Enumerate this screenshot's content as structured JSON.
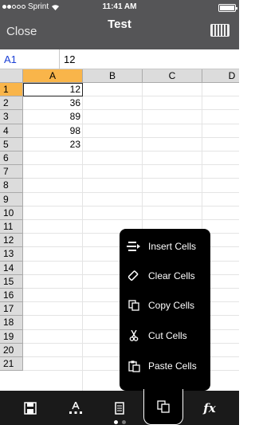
{
  "status_bar": {
    "carrier": "Sprint",
    "time": "11:41 AM"
  },
  "nav": {
    "close_label": "Close",
    "title": "Test",
    "keyboard_icon": "keyboard-icon"
  },
  "formula_bar": {
    "cell_ref": "A1",
    "value": "12"
  },
  "sheet": {
    "columns": [
      "A",
      "B",
      "C",
      "D"
    ],
    "rows": [
      "1",
      "2",
      "3",
      "4",
      "5",
      "6",
      "7",
      "8",
      "9",
      "10",
      "11",
      "12",
      "13",
      "14",
      "15",
      "16",
      "17",
      "18",
      "19",
      "20",
      "21"
    ],
    "selected_column": "A",
    "selected_row": "1",
    "column_a_values": [
      "12",
      "36",
      "89",
      "98",
      "23"
    ]
  },
  "context_menu": {
    "items": [
      {
        "label": "Insert Cells",
        "icon": "insert-cells-icon"
      },
      {
        "label": "Clear Cells",
        "icon": "eraser-icon"
      },
      {
        "label": "Copy Cells",
        "icon": "copy-icon"
      },
      {
        "label": "Cut Cells",
        "icon": "scissors-icon"
      },
      {
        "label": "Paste Cells",
        "icon": "paste-icon"
      }
    ]
  },
  "toolbar": {
    "tabs": [
      {
        "icon": "save-icon"
      },
      {
        "icon": "format-icon"
      },
      {
        "icon": "document-icon"
      },
      {
        "icon": "cells-icon",
        "active": true
      },
      {
        "icon": "function-icon",
        "glyph": "fx"
      }
    ],
    "page_count": 2,
    "active_page": 1
  },
  "colors": {
    "bar_background": "#555557",
    "header_gray": "#dcdcdc",
    "selected_header": "#f9b54a",
    "cell_ref_blue": "#1a3fd6"
  }
}
